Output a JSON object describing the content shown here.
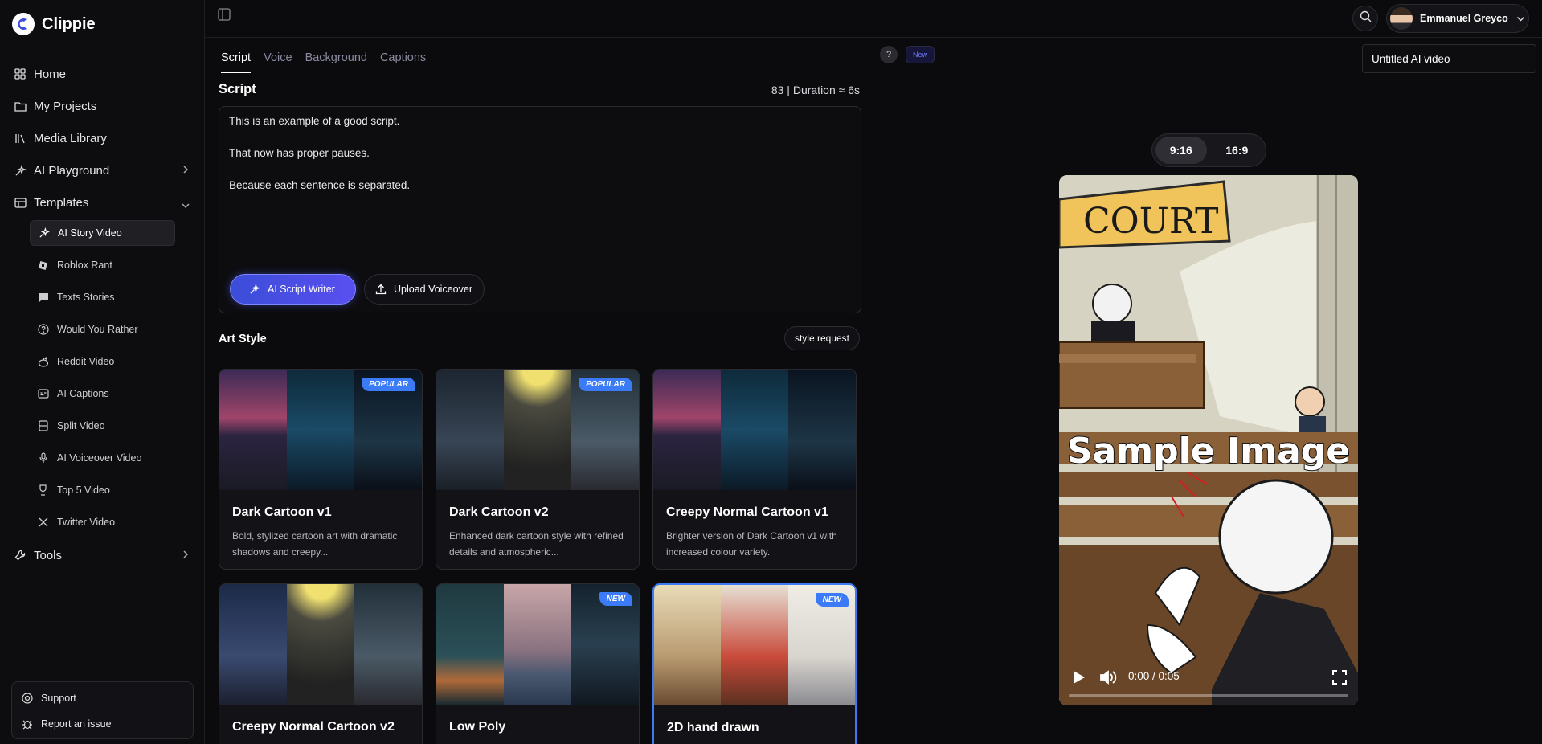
{
  "app": {
    "name": "Clippie"
  },
  "sidebar": {
    "items": [
      {
        "label": "Home",
        "icon": "grid-icon"
      },
      {
        "label": "My Projects",
        "icon": "folder-icon"
      },
      {
        "label": "Media Library",
        "icon": "library-icon"
      },
      {
        "label": "AI Playground",
        "icon": "sparkle-icon"
      },
      {
        "label": "Templates",
        "icon": "template-icon"
      }
    ],
    "templates": [
      {
        "label": "AI Story Video",
        "icon": "sparkle-icon",
        "active": true
      },
      {
        "label": "Roblox Rant",
        "icon": "roblox-icon"
      },
      {
        "label": "Texts Stories",
        "icon": "chat-icon"
      },
      {
        "label": "Would You Rather",
        "icon": "question-icon"
      },
      {
        "label": "Reddit Video",
        "icon": "reddit-icon"
      },
      {
        "label": "AI Captions",
        "icon": "captions-icon"
      },
      {
        "label": "Split Video",
        "icon": "split-icon"
      },
      {
        "label": "AI Voiceover Video",
        "icon": "mic-icon"
      },
      {
        "label": "Top 5 Video",
        "icon": "trophy-icon"
      },
      {
        "label": "Twitter Video",
        "icon": "x-icon"
      }
    ],
    "tools_label": "Tools",
    "support_label": "Support",
    "report_label": "Report an issue"
  },
  "topbar": {
    "user_name": "Emmanuel Greyco"
  },
  "editor": {
    "tabs": [
      "Script",
      "Voice",
      "Background",
      "Captions"
    ],
    "active_tab": "Script",
    "script_title": "Script",
    "duration": "83 | Duration ≈ 6s",
    "script_lines": [
      "This is an example of a good script.",
      "That now has proper pauses.",
      "Because each sentence is separated."
    ],
    "ai_writer_label": "AI Script Writer",
    "upload_label": "Upload Voiceover",
    "art_style_title": "Art Style",
    "style_request_label": "style request",
    "styles": [
      {
        "title": "Dark Cartoon v1",
        "desc": "Bold, stylized cartoon art with dramatic shadows and creepy...",
        "badge": "POPULAR"
      },
      {
        "title": "Dark Cartoon v2",
        "desc": "Enhanced dark cartoon style with refined details and atmospheric...",
        "badge": "POPULAR"
      },
      {
        "title": "Creepy Normal Cartoon v1",
        "desc": "Brighter version of Dark Cartoon v1 with increased colour variety.",
        "badge": ""
      },
      {
        "title": "Creepy Normal Cartoon v2",
        "desc": "",
        "badge": ""
      },
      {
        "title": "Low Poly",
        "desc": "",
        "badge": "NEW"
      },
      {
        "title": "2D hand drawn",
        "desc": "",
        "badge": "NEW",
        "selected": true
      }
    ]
  },
  "preview": {
    "help_label": "?",
    "new_label": "New",
    "video_title": "Untitled AI video",
    "ratios": [
      "9:16",
      "16:9"
    ],
    "active_ratio": "9:16",
    "overlay_text": "Sample Image",
    "time": "0:00 / 0:05"
  },
  "colors": {
    "accent": "#3d7bf5",
    "badge": "#3b7bf7",
    "background": "#0b0b0d"
  }
}
